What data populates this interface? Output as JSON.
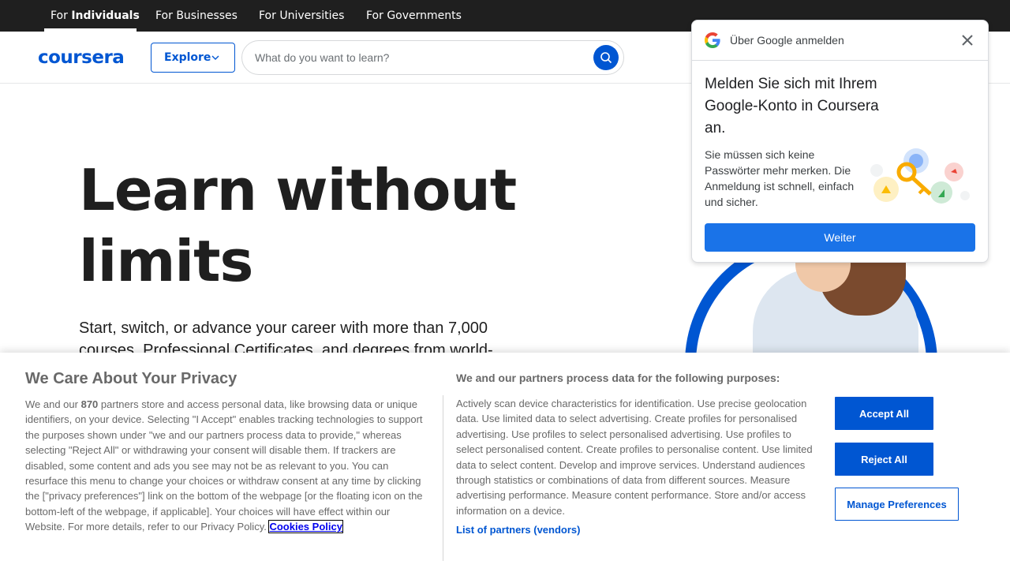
{
  "topbar": {
    "tabs": [
      {
        "prefix": "For ",
        "bold": "Individuals"
      },
      {
        "label": "For Businesses"
      },
      {
        "label": "For Universities"
      },
      {
        "label": "For Governments"
      }
    ]
  },
  "header": {
    "logo": "coursera",
    "explore_label": "Explore",
    "search_placeholder": "What do you want to learn?"
  },
  "hero": {
    "title_line1": "Learn without",
    "title_line2": "limits",
    "subtitle": "Start, switch, or advance your career with more than 7,000 courses, Professional Certificates, and degrees from world-class"
  },
  "google_dialog": {
    "title": "Über Google anmelden",
    "heading": "Melden Sie sich mit Ihrem Google-Konto in Coursera an.",
    "body": "Sie müssen sich keine Passwörter mehr merken. Die Anmeldung ist schnell, einfach und sicher.",
    "button": "Weiter"
  },
  "privacy": {
    "title": "We Care About Your Privacy",
    "text_before": "We and our ",
    "partner_count": "870",
    "text_after": " partners store and access personal data, like browsing data or unique identifiers, on your device. Selecting \"I Accept\" enables tracking technologies to support the purposes shown under \"we and our partners process data to provide,\" whereas selecting \"Reject All\" or withdrawing your consent will disable them. If trackers are disabled, some content and ads you see may not be as relevant to you. You can resurface this menu to change your choices or withdraw consent at any time by clicking the [\"privacy preferences\"] link on the bottom of the webpage [or the floating icon on the bottom-left of the webpage, if applicable]. Your choices will have effect within our Website. For more details, refer to our Privacy Policy.",
    "cookies_link": "Cookies Policy",
    "purposes_title": "We and our partners process data for the following purposes:",
    "purposes_text": "Actively scan device characteristics for identification. Use precise geolocation data. Use limited data to select advertising. Create profiles for personalised advertising. Use profiles to select personalised advertising. Use profiles to select personalised content. Create profiles to personalise content. Use limited data to select content. Develop and improve services. Understand audiences through statistics or combinations of data from different sources. Measure advertising performance. Measure content performance. Store and/or access information on a device.",
    "vendors_link": "List of partners (vendors)",
    "accept_label": "Accept All",
    "reject_label": "Reject All",
    "manage_label": "Manage Preferences"
  },
  "colors": {
    "brand_blue": "#0056d2",
    "google_blue": "#1a73e8",
    "topbar_bg": "#1f1f1f"
  }
}
